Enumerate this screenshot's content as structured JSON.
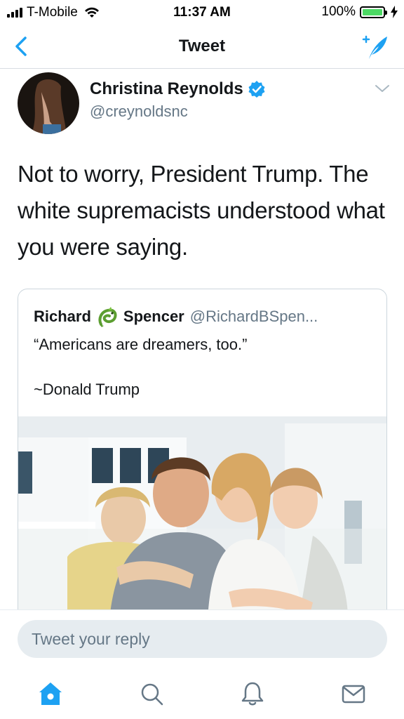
{
  "status_bar": {
    "carrier": "T-Mobile",
    "time": "11:37 AM",
    "battery_percent": "100%",
    "battery_level": 1.0,
    "icons": [
      "signal-icon",
      "wifi-icon",
      "battery-icon",
      "charging-bolt-icon"
    ]
  },
  "nav": {
    "title": "Tweet",
    "back_icon": "chevron-left-icon",
    "compose_icon": "compose-tweet-icon"
  },
  "tweet": {
    "author_name": "Christina Reynolds",
    "author_handle": "@creynoldsnc",
    "verified_icon": "verified-badge-icon",
    "menu_icon": "chevron-down-icon",
    "text": "Not to worry, President Trump. The white supremacists understood what you were saying."
  },
  "quoted_tweet": {
    "name_part1": "Richard",
    "name_emoji_icon": "dragon-emoji-icon",
    "name_part2": "Spencer",
    "handle": "@RichardBSpen...",
    "line1": "“Americans are dreamers, too.”",
    "line2": "~Donald Trump",
    "photo_icon": "family-photo"
  },
  "reply": {
    "placeholder": "Tweet your reply"
  },
  "tabs": [
    {
      "icon": "home-icon",
      "active": true
    },
    {
      "icon": "search-icon",
      "active": false
    },
    {
      "icon": "notifications-bell-icon",
      "active": false
    },
    {
      "icon": "messages-envelope-icon",
      "active": false
    }
  ],
  "colors": {
    "accent": "#1da1f2",
    "text": "#14171a",
    "secondary_text": "#657786",
    "divider": "#d8dde2",
    "input_bg": "#e6ecf0",
    "battery_green": "#4cd964"
  }
}
